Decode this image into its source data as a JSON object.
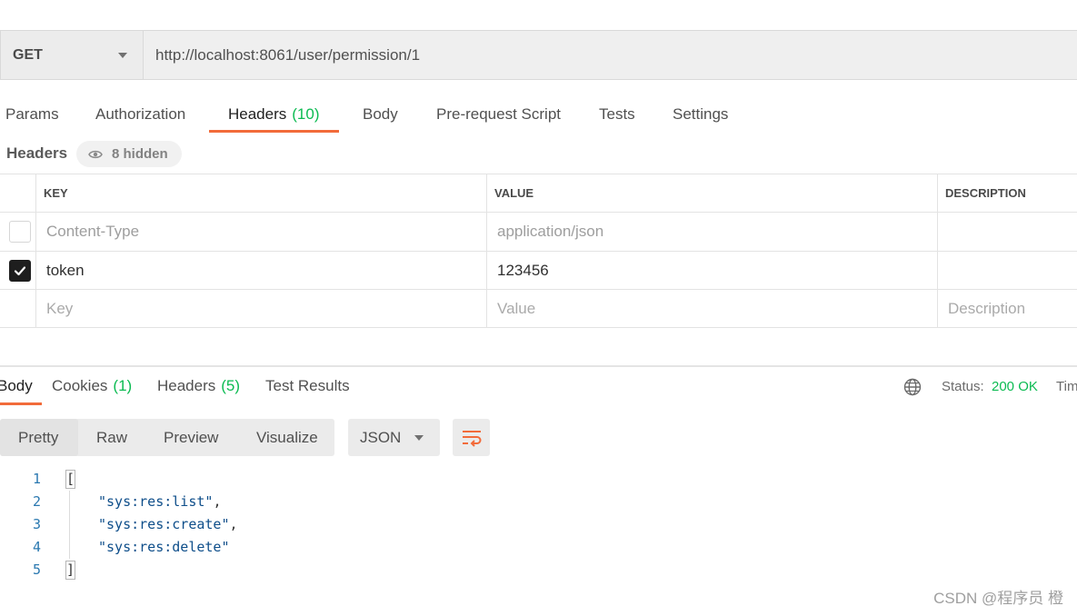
{
  "colors": {
    "accent": "#f26b3a",
    "success": "#0cbb52",
    "code_string": "#0e4e8a",
    "line_number": "#2a78b0"
  },
  "request": {
    "method": "GET",
    "method_icon": "chevron-down-icon",
    "url": "http://localhost:8061/user/permission/1"
  },
  "request_tabs": [
    {
      "label": "Params",
      "active": false
    },
    {
      "label": "Authorization",
      "active": false
    },
    {
      "label": "Headers",
      "count": "(10)",
      "active": true
    },
    {
      "label": "Body",
      "active": false
    },
    {
      "label": "Pre-request Script",
      "active": false
    },
    {
      "label": "Tests",
      "active": false
    },
    {
      "label": "Settings",
      "active": false
    }
  ],
  "headers_section": {
    "title": "Headers",
    "hidden_label": "8 hidden",
    "hidden_icon": "eye-icon"
  },
  "headers_table": {
    "columns": [
      "KEY",
      "VALUE",
      "DESCRIPTION"
    ],
    "rows": [
      {
        "key": "Content-Type",
        "value": "application/json",
        "checked": false,
        "disabled": true
      },
      {
        "key": "token",
        "value": "123456",
        "checked": true,
        "disabled": false
      }
    ],
    "placeholder": {
      "key": "Key",
      "value": "Value",
      "description": "Description"
    }
  },
  "response_tabs": [
    {
      "label": "Body",
      "active": true
    },
    {
      "label": "Cookies",
      "count": "(1)",
      "active": false
    },
    {
      "label": "Headers",
      "count": "(5)",
      "active": false
    },
    {
      "label": "Test Results",
      "active": false
    }
  ],
  "response_status": {
    "network_icon": "globe-icon",
    "status_label": "Status:",
    "status_value": "200 OK",
    "time_label": "Tim"
  },
  "view_modes": [
    {
      "label": "Pretty",
      "active": true
    },
    {
      "label": "Raw",
      "active": false
    },
    {
      "label": "Preview",
      "active": false
    },
    {
      "label": "Visualize",
      "active": false
    }
  ],
  "format": {
    "selected": "JSON",
    "icon": "chevron-down-icon"
  },
  "wrap_button": {
    "icon": "wrap-lines-icon"
  },
  "code": {
    "lines": [
      {
        "num": "1",
        "text": "["
      },
      {
        "num": "2",
        "text": "\"sys:res:list\"",
        "punct": ","
      },
      {
        "num": "3",
        "text": "\"sys:res:create\"",
        "punct": ","
      },
      {
        "num": "4",
        "text": "\"sys:res:delete\""
      },
      {
        "num": "5",
        "text": "]"
      }
    ]
  },
  "watermark": "CSDN @程序员 橙"
}
